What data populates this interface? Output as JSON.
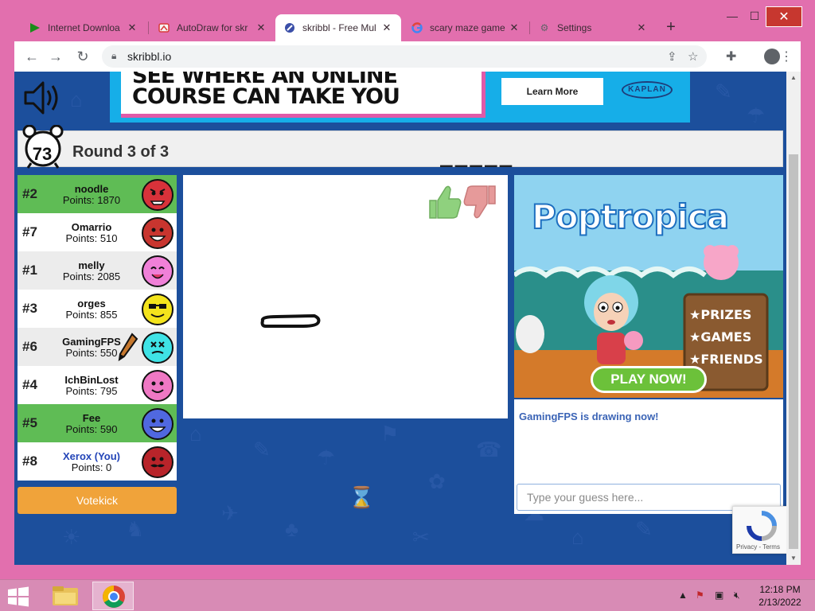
{
  "browser": {
    "tabs": [
      {
        "title": "Internet Downloa",
        "icon": "idm-icon",
        "active": false
      },
      {
        "title": "AutoDraw for skr",
        "icon": "autodraw-icon",
        "active": false
      },
      {
        "title": "skribbl - Free Mul",
        "icon": "skribbl-icon",
        "active": true
      },
      {
        "title": "scary maze game",
        "icon": "google-icon",
        "active": false
      },
      {
        "title": "Settings",
        "icon": "gear-icon",
        "active": false
      }
    ],
    "new_tab": "+",
    "url": "skribbl.io",
    "window": {
      "minimize": "—",
      "maximize": "☐",
      "close": "✕"
    }
  },
  "top_ad": {
    "line1": "SEE WHERE AN ONLINE",
    "line2": "COURSE CAN TAKE YOU",
    "button": "Learn More",
    "brand": "KAPLAN"
  },
  "round": {
    "timer": "73",
    "label": "Round 3 of 3",
    "hint": "_____"
  },
  "players": [
    {
      "rank": "#2",
      "name": "noodle",
      "points": "Points: 1870",
      "bg": "guessed",
      "avatar_color": "#d8323a",
      "face": "angry"
    },
    {
      "rank": "#7",
      "name": "Omarrio",
      "points": "Points: 510",
      "bg": "white",
      "avatar_color": "#c8352f",
      "face": "grin"
    },
    {
      "rank": "#1",
      "name": "melly",
      "points": "Points: 2085",
      "bg": "alt",
      "avatar_color": "#f080d8",
      "face": "happy"
    },
    {
      "rank": "#3",
      "name": "orges",
      "points": "Points: 855",
      "bg": "white",
      "avatar_color": "#f4e41c",
      "face": "cool"
    },
    {
      "rank": "#6",
      "name": "GamingFPS",
      "points": "Points: 550",
      "bg": "alt",
      "avatar_color": "#3fe3e6",
      "face": "dead",
      "drawing": true
    },
    {
      "rank": "#4",
      "name": "IchBinLost",
      "points": "Points: 795",
      "bg": "white",
      "avatar_color": "#ef78c4",
      "face": "smile"
    },
    {
      "rank": "#5",
      "name": "Fee",
      "points": "Points: 590",
      "bg": "guessed",
      "avatar_color": "#5068e0",
      "face": "grin"
    },
    {
      "rank": "#8",
      "name": "Xerox (You)",
      "points": "Points: 0",
      "bg": "white",
      "avatar_color": "#b8242a",
      "face": "mustache",
      "you": true
    }
  ],
  "votekick": "Votekick",
  "side_ad": {
    "title": "Poptropica",
    "lines": [
      "PRIZES",
      "GAMES",
      "FRIENDS"
    ],
    "bullet": "★",
    "cta": "PLAY NOW!"
  },
  "chat": {
    "message": "GamingFPS is drawing now!",
    "placeholder": "Type your guess here..."
  },
  "recaptcha": {
    "links": "Privacy - Terms"
  },
  "taskbar": {
    "time": "12:18 PM",
    "date": "2/13/2022"
  },
  "colors": {
    "guessed": "#5fbc55",
    "page_bg": "#1c4f9c",
    "frame": "#e26fae",
    "votekick": "#f0a33a"
  }
}
